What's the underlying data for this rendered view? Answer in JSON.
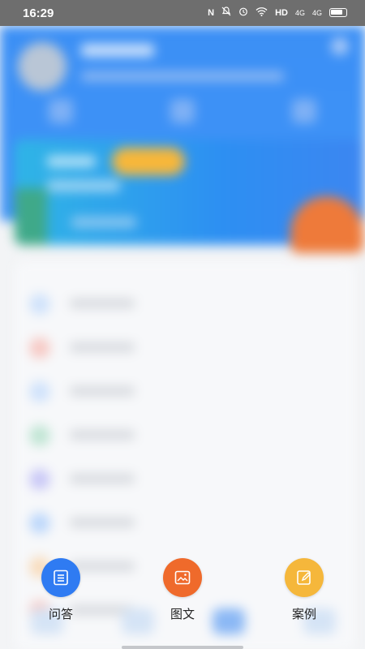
{
  "status_bar": {
    "time": "16:29",
    "icons": [
      "nfc-icon",
      "bell-off-icon",
      "alarm-icon",
      "wifi-icon",
      "HD",
      "4G",
      "4G",
      "battery-icon"
    ],
    "hd_label": "HD",
    "net1_label": "4G",
    "net2_label": "4G"
  },
  "actions": [
    {
      "label": "问答",
      "color": "#2f7bf2",
      "icon": "list-icon"
    },
    {
      "label": "图文",
      "color": "#ef6a2b",
      "icon": "image-icon"
    },
    {
      "label": "案例",
      "color": "#f5b73b",
      "icon": "edit-icon"
    }
  ],
  "background_colors": {
    "header": "#3b8ff5",
    "card_gradient_start": "#2fb5e6",
    "accent_orange": "#ee7a3a",
    "tag_yellow": "#f7b73a"
  },
  "list_icon_colors": [
    "#cfe2fb",
    "#f7c9c4",
    "#cfe2fb",
    "#bfe5d3",
    "#c9c8f7",
    "#bcd7fb",
    "#f8dcbc",
    "#f7c9c4"
  ]
}
